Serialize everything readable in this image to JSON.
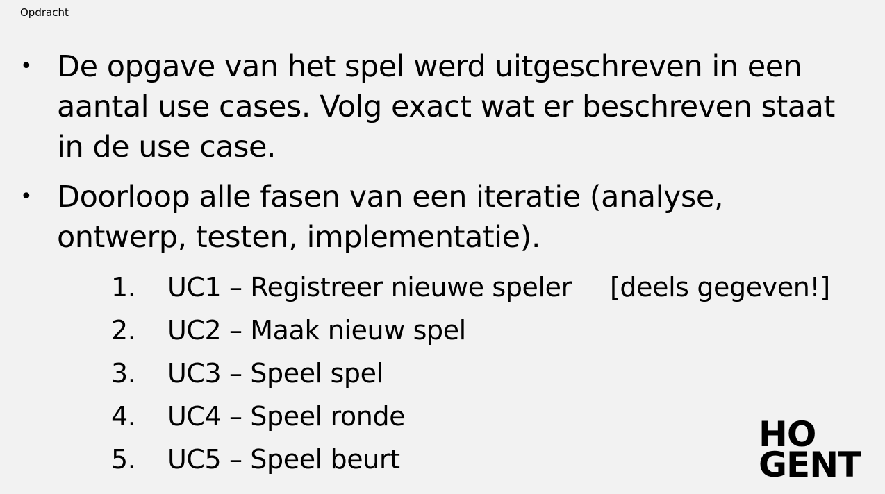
{
  "slide": {
    "title": "Opdracht",
    "bullets": [
      {
        "lines": [
          "De opgave van het spel werd uitgeschreven in een",
          "aantal use cases. Volg exact wat er beschreven staat",
          "in de use case."
        ]
      },
      {
        "lines": [
          "Doorloop alle fasen van een iteratie (analyse,",
          "ontwerp, testen, implementatie)."
        ]
      }
    ],
    "bullet_symbol": "•",
    "use_cases": [
      {
        "number": "1.",
        "text": "UC1 – Registreer nieuwe speler",
        "note": "[deels gegeven!]"
      },
      {
        "number": "2.",
        "text": "UC2 – Maak nieuw spel"
      },
      {
        "number": "3.",
        "text": "UC3 – Speel spel"
      },
      {
        "number": "4.",
        "text": "UC4 – Speel ronde"
      },
      {
        "number": "5.",
        "text": "UC5 – Speel beurt"
      }
    ]
  },
  "logo": {
    "line1": "HO",
    "line2": "GENT"
  }
}
